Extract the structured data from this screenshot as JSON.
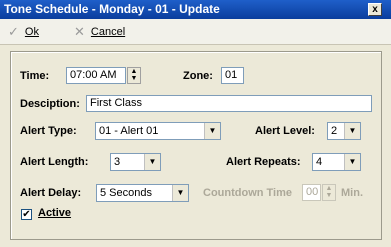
{
  "window": {
    "title": "Tone Schedule - Monday - 01 - Update",
    "close_label": "x"
  },
  "toolbar": {
    "ok_label": "Ok",
    "cancel_label": "Cancel",
    "ok_icon": "✓",
    "cancel_icon": "✕"
  },
  "form": {
    "time_label": "Time:",
    "time_value": "07:00 AM",
    "zone_label": "Zone:",
    "zone_value": "01",
    "description_label": "Desciption:",
    "description_value": "First Class",
    "alert_type_label": "Alert Type:",
    "alert_type_value": "01 - Alert 01",
    "alert_level_label": "Alert Level:",
    "alert_level_value": "2",
    "alert_length_label": "Alert Length:",
    "alert_length_value": "3",
    "alert_repeats_label": "Alert Repeats:",
    "alert_repeats_value": "4",
    "alert_delay_label": "Alert Delay:",
    "alert_delay_value": "5 Seconds",
    "countdown_label": "Countdown Time",
    "countdown_value": "00",
    "countdown_unit": "Min.",
    "active_label": "Active",
    "active_checked": true
  }
}
